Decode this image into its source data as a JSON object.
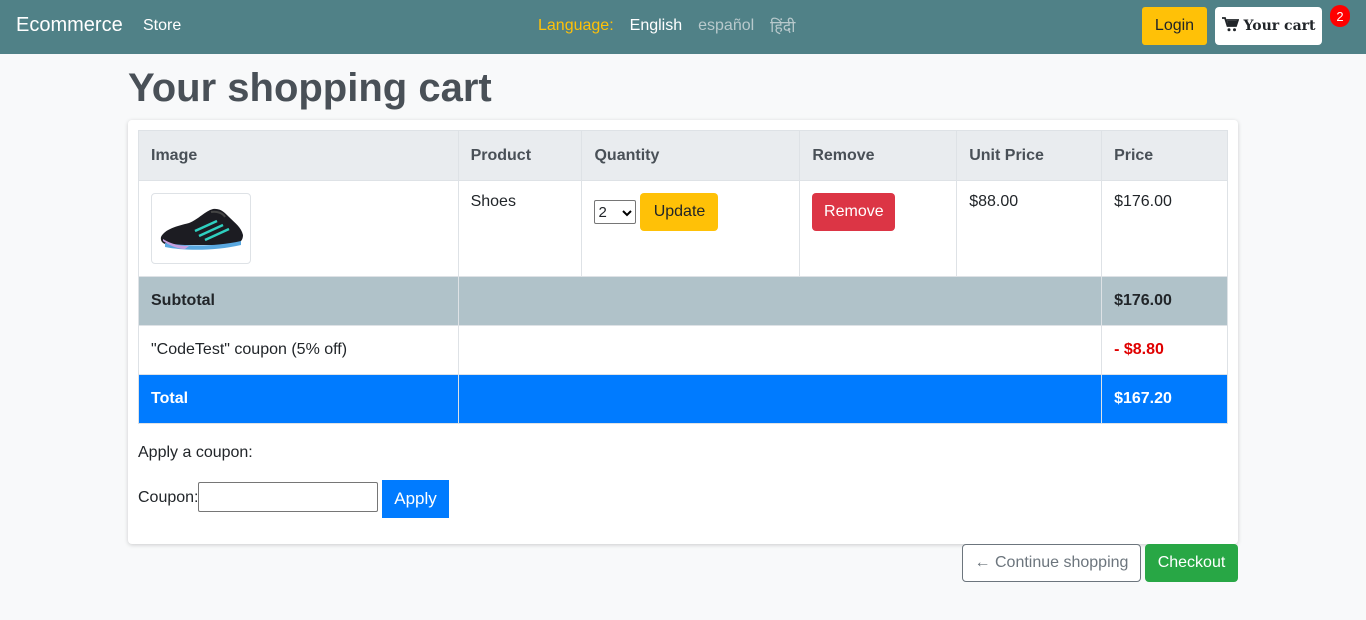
{
  "navbar": {
    "brand": "Ecommerce",
    "store": "Store",
    "language_label": "Language:",
    "languages": [
      "English",
      "español",
      "हिंदी"
    ],
    "login": "Login",
    "cart_label": "Your cart",
    "cart_count": "2"
  },
  "page_title": "Your shopping cart",
  "table": {
    "headers": [
      "Image",
      "Product",
      "Quantity",
      "Remove",
      "Unit Price",
      "Price"
    ],
    "item": {
      "product": "Shoes",
      "quantity": "2",
      "update_label": "Update",
      "remove_label": "Remove",
      "unit_price": "$88.00",
      "price": "$176.00"
    },
    "subtotal_label": "Subtotal",
    "subtotal_value": "$176.00",
    "coupon_label": "\"CodeTest\" coupon (5% off)",
    "coupon_value": "- $8.80",
    "total_label": "Total",
    "total_value": "$167.20"
  },
  "coupon_form": {
    "heading": "Apply a coupon:",
    "label": "Coupon:",
    "value": "",
    "apply_label": "Apply"
  },
  "footer": {
    "continue_label": "← Continue shopping",
    "checkout_label": "Checkout"
  },
  "colors": {
    "navbar": "#508187",
    "warning": "#ffc107",
    "danger": "#dc3545",
    "primary": "#007bff",
    "success": "#28a745"
  }
}
